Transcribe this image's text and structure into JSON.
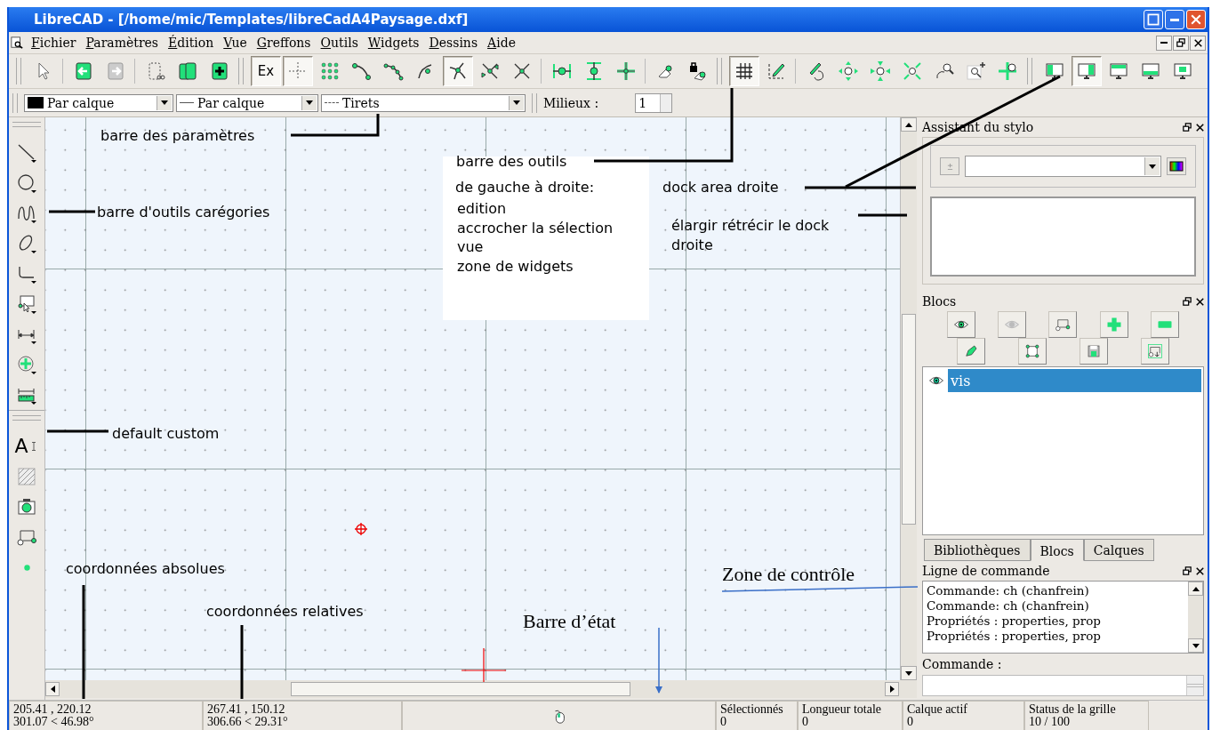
{
  "window": {
    "title": "LibreCAD - [/home/mic/Templates/libreCadA4Paysage.dxf]"
  },
  "menu": [
    "Fichier",
    "Paramètres",
    "Édition",
    "Vue",
    "Greffons",
    "Outils",
    "Widgets",
    "Dessins",
    "Aide"
  ],
  "main_toolbar": [
    {
      "grip": true,
      "buttons": [
        {
          "kind": "select",
          "pressed": false
        }
      ]
    },
    {
      "grip": false,
      "buttons": [
        {
          "kind": "open-left",
          "pressed": false
        },
        {
          "kind": "open-right",
          "pressed": false
        }
      ]
    },
    {
      "grip": false,
      "buttons": [
        {
          "kind": "cut",
          "pressed": false
        },
        {
          "kind": "copy",
          "pressed": false
        },
        {
          "kind": "paste",
          "pressed": false
        }
      ]
    },
    {
      "grip": true,
      "buttons": [
        {
          "kind": "text",
          "label": "Ex",
          "pressed": true
        },
        {
          "kind": "crosshair",
          "pressed": true
        },
        {
          "kind": "dots",
          "pressed": false
        },
        {
          "kind": "snap-end",
          "pressed": false
        },
        {
          "kind": "snap-entity",
          "pressed": false
        },
        {
          "kind": "snap-center",
          "pressed": false
        },
        {
          "kind": "snap-intersect",
          "pressed": true
        },
        {
          "kind": "snap-middle",
          "pressed": false
        },
        {
          "kind": "snap-x",
          "pressed": false
        }
      ]
    },
    {
      "grip": false,
      "buttons": [
        {
          "kind": "restrict-h",
          "pressed": false
        },
        {
          "kind": "restrict-v",
          "pressed": false
        },
        {
          "kind": "restrict-o",
          "pressed": false
        }
      ]
    },
    {
      "grip": false,
      "buttons": [
        {
          "kind": "eraser",
          "pressed": false
        },
        {
          "kind": "lock",
          "pressed": false
        }
      ]
    },
    {
      "grip": true,
      "buttons": [
        {
          "kind": "grid",
          "pressed": true
        },
        {
          "kind": "draft",
          "pressed": false
        }
      ]
    },
    {
      "grip": false,
      "buttons": [
        {
          "kind": "redraw",
          "pressed": false
        },
        {
          "kind": "zoom-in",
          "pressed": false
        },
        {
          "kind": "zoom-out",
          "pressed": false
        },
        {
          "kind": "zoom-fit",
          "pressed": false
        },
        {
          "kind": "zoom-back",
          "pressed": false
        },
        {
          "kind": "zoom-window",
          "pressed": false
        },
        {
          "kind": "zoom-pan",
          "pressed": false
        }
      ]
    },
    {
      "grip": true,
      "buttons": [
        {
          "kind": "dock-left",
          "pressed": false
        },
        {
          "kind": "dock-right",
          "pressed": true
        },
        {
          "kind": "dock-top",
          "pressed": false
        },
        {
          "kind": "dock-bottom",
          "pressed": false
        },
        {
          "kind": "dock-float",
          "pressed": false
        }
      ]
    }
  ],
  "pen_toolbar": {
    "combos": [
      "Par calque",
      "Par calque",
      "Tirets"
    ],
    "snap_label": "Milieux :",
    "snap_value": "1"
  },
  "left_toolbar": [
    {
      "menus": true,
      "buttons": [
        {
          "kind": "line"
        },
        {
          "kind": "circle"
        },
        {
          "kind": "spline"
        },
        {
          "kind": "ellipse"
        },
        {
          "kind": "polyline"
        },
        {
          "kind": "selection"
        },
        {
          "kind": "dimension"
        },
        {
          "kind": "move"
        },
        {
          "kind": "ruler"
        }
      ]
    },
    {
      "menus": false,
      "buttons": [
        {
          "kind": "text",
          "label": "A"
        },
        {
          "kind": "hatch"
        },
        {
          "kind": "camera"
        },
        {
          "kind": "block"
        },
        {
          "kind": "point"
        }
      ]
    }
  ],
  "pen_wizard": {
    "title": "Assistant du stylo"
  },
  "blocks": {
    "title": "Blocs",
    "items": [
      {
        "label": "vis",
        "selected": true
      }
    ]
  },
  "dock_tabs": [
    {
      "label": "Bibliothèques",
      "selected": false
    },
    {
      "label": "Blocs",
      "selected": true
    },
    {
      "label": "Calques",
      "selected": false
    }
  ],
  "command": {
    "title": "Ligne de commande",
    "history": [
      "Commande: ch (chanfrein)",
      "Commande: ch (chanfrein)",
      "Propriétés : properties, prop",
      "Propriétés : properties, prop"
    ],
    "label": "Commande :"
  },
  "status_bar": {
    "absolute": [
      "205.41 , 220.12",
      "301.07 < 46.98°"
    ],
    "relative": [
      "267.41 , 150.12",
      "306.66 < 29.31°"
    ],
    "fields": [
      {
        "label": "Sélectionnés",
        "value": "0"
      },
      {
        "label": "Longueur totale",
        "value": "0"
      },
      {
        "label": "Calque actif",
        "value": "0"
      },
      {
        "label": "Status de la grille",
        "value": "10 / 100"
      }
    ]
  },
  "annotations": [
    {
      "text": "barre des paramètres",
      "kind": "note"
    },
    {
      "text": "barre des outils",
      "kind": "note"
    },
    {
      "text": "de gauche à droite:",
      "kind": "note"
    },
    {
      "text": "dock area droite",
      "kind": "note"
    },
    {
      "text": "barre d'outils carégories",
      "kind": "note"
    },
    {
      "text": "edition",
      "kind": "note"
    },
    {
      "text": "accrocher la sélection",
      "kind": "note"
    },
    {
      "text": "vue",
      "kind": "note"
    },
    {
      "text": "élargir rétrécir le dock droite",
      "kind": "note"
    },
    {
      "text": "zone de widgets",
      "kind": "note"
    },
    {
      "text": "default custom",
      "kind": "note"
    },
    {
      "text": "coordonnées absolues",
      "kind": "note"
    },
    {
      "text": "Zone de contrôle",
      "kind": "caption"
    },
    {
      "text": "coordonnées relatives",
      "kind": "note"
    },
    {
      "text": "Barre d’état",
      "kind": "caption"
    }
  ]
}
